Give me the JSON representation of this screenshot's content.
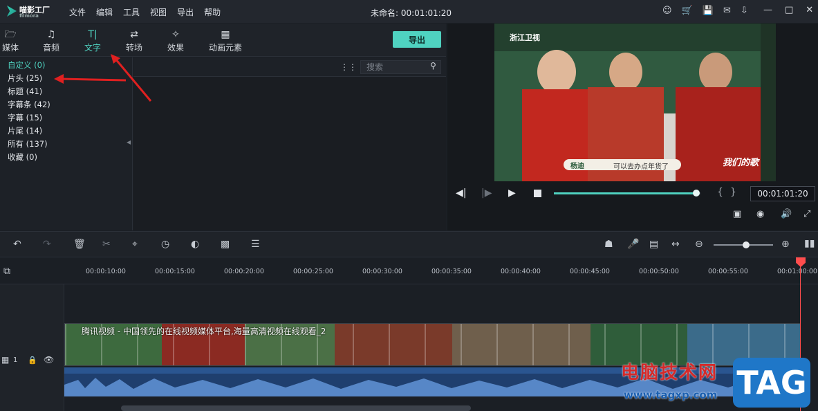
{
  "app": {
    "logo_text": "喵影工厂",
    "logo_sub": "filmora",
    "document_title": "未命名: 00:01:01:20"
  },
  "menu": [
    "文件",
    "编辑",
    "工具",
    "视图",
    "导出",
    "帮助"
  ],
  "window_icons": [
    "account-icon",
    "cart-icon",
    "save-icon",
    "mail-icon",
    "download-icon"
  ],
  "window_controls": [
    "minimize-icon",
    "maximize-icon",
    "close-icon"
  ],
  "tabs": [
    {
      "label": "媒体",
      "icon": "folder-icon"
    },
    {
      "label": "音频",
      "icon": "music-note-icon"
    },
    {
      "label": "文字",
      "icon": "text-icon",
      "active": true
    },
    {
      "label": "转场",
      "icon": "transition-icon"
    },
    {
      "label": "效果",
      "icon": "effects-icon"
    },
    {
      "label": "动画元素",
      "icon": "image-icon"
    }
  ],
  "export_label": "导出",
  "categories": [
    {
      "label": "自定义 (0)",
      "active": true
    },
    {
      "label": "片头 (25)"
    },
    {
      "label": "标题 (41)"
    },
    {
      "label": "字幕条 (42)"
    },
    {
      "label": "字幕 (15)"
    },
    {
      "label": "片尾 (14)"
    },
    {
      "label": "所有 (137)"
    },
    {
      "label": "收藏 (0)"
    }
  ],
  "search": {
    "placeholder": "搜索"
  },
  "video_overlay": {
    "channel": "浙江卫视",
    "caption_name": "杨迪",
    "caption_text": "可以去办点年货了",
    "show_logo": "我们的歌"
  },
  "preview": {
    "timecode": "00:01:01:20",
    "progress": 0.97,
    "bracket_in": "{",
    "bracket_out": "}"
  },
  "toolbar_icons": [
    "undo-icon",
    "redo-icon",
    "delete-icon",
    "cut-icon",
    "crop-icon",
    "speed-icon",
    "color-icon",
    "green-screen-icon",
    "adjust-icon"
  ],
  "toolbar_right_icons": [
    "marker-icon",
    "mic-icon",
    "voiceover-icon",
    "fit-icon",
    "zoom-out-icon",
    "zoom-in-icon",
    "split-view-icon"
  ],
  "zoom_level": 0.55,
  "ruler_ticks": [
    "00:00:10:00",
    "00:00:15:00",
    "00:00:20:00",
    "00:00:25:00",
    "00:00:30:00",
    "00:00:35:00",
    "00:00:40:00",
    "00:00:45:00",
    "00:00:50:00",
    "00:00:55:00",
    "00:01:00:00"
  ],
  "track": {
    "number": "1"
  },
  "clip_title": "腾讯视频 - 中国领先的在线视频媒体平台,海量高清视频在线观看_2",
  "watermark": {
    "text": "电脑技术网",
    "url": "www.tagxp.com",
    "badge": "TAG"
  },
  "colors": {
    "accent": "#4fd2c0",
    "playhead": "#ff4d4d",
    "arrow": "#e02020"
  }
}
